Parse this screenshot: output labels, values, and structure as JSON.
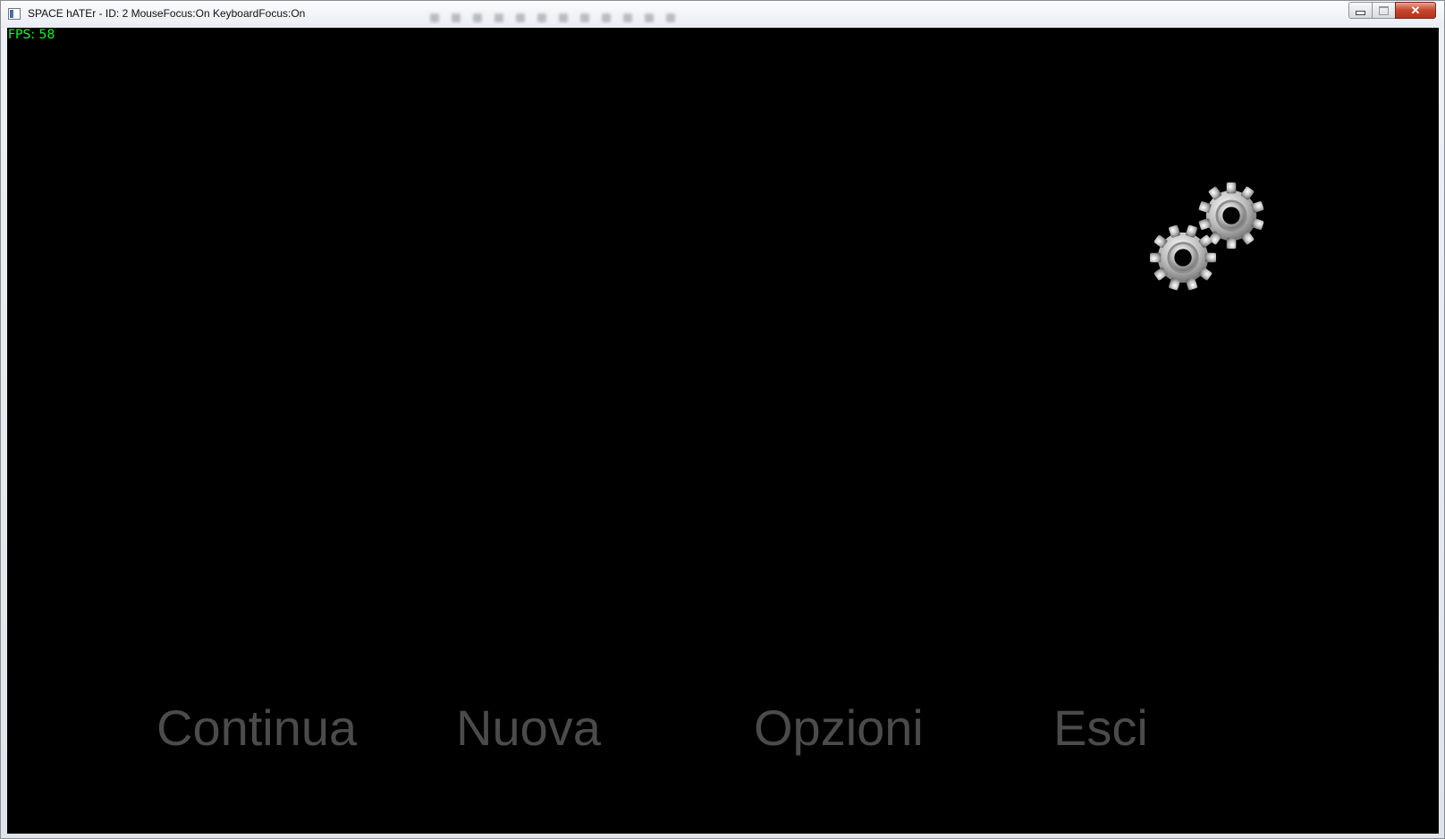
{
  "window": {
    "title": "SPACE hATEr - ID: 2 MouseFocus:On KeyboardFocus:On",
    "close_glyph": "✕"
  },
  "hud": {
    "fps_label": "FPS: 58",
    "fps_color": "#00ff2a"
  },
  "main_menu": {
    "items": [
      {
        "label": "Continua",
        "icon": null
      },
      {
        "label": "Nuova",
        "icon": null
      },
      {
        "label": "Opzioni",
        "icon": null
      },
      {
        "label": "Esci",
        "icon": null
      }
    ],
    "item_color": "#4b4b4b"
  },
  "loading_indicator": {
    "icon": "gears-icon"
  },
  "colors": {
    "canvas_background": "#000000",
    "close_button": "#c7452c"
  }
}
